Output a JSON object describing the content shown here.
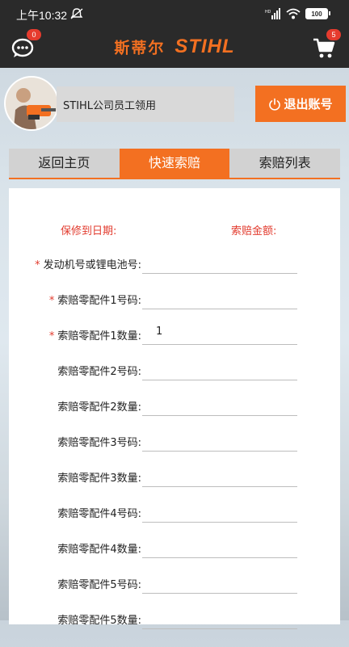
{
  "status_bar": {
    "time": "上午10:32",
    "battery": "100"
  },
  "header": {
    "brand_cn": "斯蒂尔",
    "brand_en": "STIHL",
    "chat_badge": "0",
    "cart_badge": "5"
  },
  "user": {
    "name": "STIHL公司员工领用",
    "logout_label": "退出账号"
  },
  "tabs": [
    {
      "label": "返回主页",
      "active": false
    },
    {
      "label": "快速索赔",
      "active": true
    },
    {
      "label": "索赔列表",
      "active": false
    }
  ],
  "form": {
    "warranty_date_label": "保修到日期:",
    "claim_amount_label": "索赔金额:",
    "fields": [
      {
        "label": "发动机号或锂电池号:",
        "required": true,
        "value": ""
      },
      {
        "label": "索赔零配件1号码:",
        "required": true,
        "value": ""
      },
      {
        "label": "索赔零配件1数量:",
        "required": true,
        "value": "1"
      },
      {
        "label": "索赔零配件2号码:",
        "required": false,
        "value": ""
      },
      {
        "label": "索赔零配件2数量:",
        "required": false,
        "value": ""
      },
      {
        "label": "索赔零配件3号码:",
        "required": false,
        "value": ""
      },
      {
        "label": "索赔零配件3数量:",
        "required": false,
        "value": ""
      },
      {
        "label": "索赔零配件4号码:",
        "required": false,
        "value": ""
      },
      {
        "label": "索赔零配件4数量:",
        "required": false,
        "value": ""
      },
      {
        "label": "索赔零配件5号码:",
        "required": false,
        "value": ""
      },
      {
        "label": "索赔零配件5数量:",
        "required": false,
        "value": ""
      }
    ]
  },
  "colors": {
    "accent": "#f37021",
    "required": "#e23b2e",
    "bar": "#2a2a2a"
  }
}
